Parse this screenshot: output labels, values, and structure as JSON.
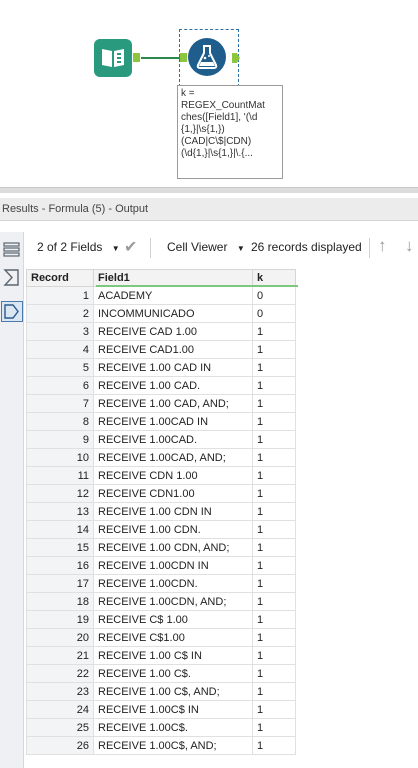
{
  "canvas": {
    "annotation_text": "k =\nREGEX_CountMat\nches([Field1], '(\\d\n{1,}|\\s{1,})\n(CAD|C\\$|CDN)\n(\\d{1,}|\\s{1,}|\\.{..."
  },
  "results": {
    "title": "Results - Formula (5) - Output",
    "fields_label": "2 of 2 Fields",
    "viewer_label": "Cell Viewer",
    "records_label": "26 records displayed"
  },
  "table": {
    "headers": [
      "Record",
      "Field1",
      "k"
    ],
    "rows": [
      [
        "1",
        "ACADEMY",
        "0"
      ],
      [
        "2",
        "INCOMMUNICADO",
        "0"
      ],
      [
        "3",
        "RECEIVE CAD 1.00",
        "1"
      ],
      [
        "4",
        "RECEIVE CAD1.00",
        "1"
      ],
      [
        "5",
        "RECEIVE 1.00 CAD IN",
        "1"
      ],
      [
        "6",
        "RECEIVE 1.00 CAD.",
        "1"
      ],
      [
        "7",
        "RECEIVE 1.00 CAD, AND;",
        "1"
      ],
      [
        "8",
        "RECEIVE 1.00CAD IN",
        "1"
      ],
      [
        "9",
        "RECEIVE 1.00CAD.",
        "1"
      ],
      [
        "10",
        "RECEIVE 1.00CAD, AND;",
        "1"
      ],
      [
        "11",
        "RECEIVE CDN 1.00",
        "1"
      ],
      [
        "12",
        "RECEIVE CDN1.00",
        "1"
      ],
      [
        "13",
        "RECEIVE 1.00 CDN IN",
        "1"
      ],
      [
        "14",
        "RECEIVE 1.00 CDN.",
        "1"
      ],
      [
        "15",
        "RECEIVE 1.00 CDN, AND;",
        "1"
      ],
      [
        "16",
        "RECEIVE 1.00CDN IN",
        "1"
      ],
      [
        "17",
        "RECEIVE 1.00CDN.",
        "1"
      ],
      [
        "18",
        "RECEIVE 1.00CDN, AND;",
        "1"
      ],
      [
        "19",
        "RECEIVE C$ 1.00",
        "1"
      ],
      [
        "20",
        "RECEIVE C$1.00",
        "1"
      ],
      [
        "21",
        "RECEIVE 1.00 C$ IN",
        "1"
      ],
      [
        "22",
        "RECEIVE 1.00 C$.",
        "1"
      ],
      [
        "23",
        "RECEIVE 1.00 C$, AND;",
        "1"
      ],
      [
        "24",
        "RECEIVE 1.00C$ IN",
        "1"
      ],
      [
        "25",
        "RECEIVE 1.00C$.",
        "1"
      ],
      [
        "26",
        "RECEIVE 1.00C$, AND;",
        "1"
      ]
    ]
  },
  "colors": {
    "input_tool": "#2a9a7e",
    "formula_tool": "#1f5d8c",
    "anchor": "#8cc63f",
    "connection": "#2a8a4a",
    "selection": "#2f6fa8"
  },
  "icons": [
    "book-input-icon",
    "flask-formula-icon",
    "list-view-icon",
    "sigma-icon",
    "tag-icon",
    "chevron-down-icon",
    "checkmark-icon",
    "arrow-up-icon",
    "arrow-down-icon"
  ]
}
